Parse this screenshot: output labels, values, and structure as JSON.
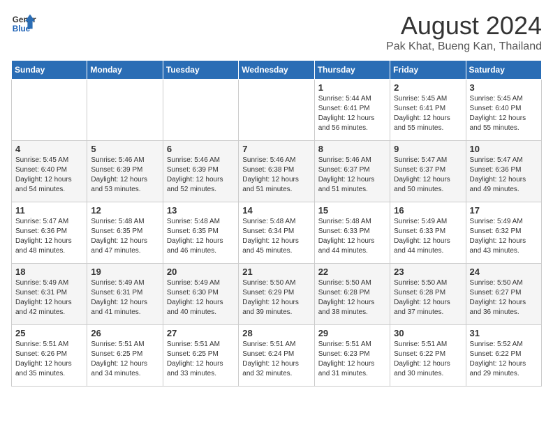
{
  "header": {
    "logo_line1": "General",
    "logo_line2": "Blue",
    "title": "August 2024",
    "subtitle": "Pak Khat, Bueng Kan, Thailand"
  },
  "weekdays": [
    "Sunday",
    "Monday",
    "Tuesday",
    "Wednesday",
    "Thursday",
    "Friday",
    "Saturday"
  ],
  "weeks": [
    [
      {
        "day": "",
        "content": ""
      },
      {
        "day": "",
        "content": ""
      },
      {
        "day": "",
        "content": ""
      },
      {
        "day": "",
        "content": ""
      },
      {
        "day": "1",
        "content": "Sunrise: 5:44 AM\nSunset: 6:41 PM\nDaylight: 12 hours\nand 56 minutes."
      },
      {
        "day": "2",
        "content": "Sunrise: 5:45 AM\nSunset: 6:41 PM\nDaylight: 12 hours\nand 55 minutes."
      },
      {
        "day": "3",
        "content": "Sunrise: 5:45 AM\nSunset: 6:40 PM\nDaylight: 12 hours\nand 55 minutes."
      }
    ],
    [
      {
        "day": "4",
        "content": "Sunrise: 5:45 AM\nSunset: 6:40 PM\nDaylight: 12 hours\nand 54 minutes."
      },
      {
        "day": "5",
        "content": "Sunrise: 5:46 AM\nSunset: 6:39 PM\nDaylight: 12 hours\nand 53 minutes."
      },
      {
        "day": "6",
        "content": "Sunrise: 5:46 AM\nSunset: 6:39 PM\nDaylight: 12 hours\nand 52 minutes."
      },
      {
        "day": "7",
        "content": "Sunrise: 5:46 AM\nSunset: 6:38 PM\nDaylight: 12 hours\nand 51 minutes."
      },
      {
        "day": "8",
        "content": "Sunrise: 5:46 AM\nSunset: 6:37 PM\nDaylight: 12 hours\nand 51 minutes."
      },
      {
        "day": "9",
        "content": "Sunrise: 5:47 AM\nSunset: 6:37 PM\nDaylight: 12 hours\nand 50 minutes."
      },
      {
        "day": "10",
        "content": "Sunrise: 5:47 AM\nSunset: 6:36 PM\nDaylight: 12 hours\nand 49 minutes."
      }
    ],
    [
      {
        "day": "11",
        "content": "Sunrise: 5:47 AM\nSunset: 6:36 PM\nDaylight: 12 hours\nand 48 minutes."
      },
      {
        "day": "12",
        "content": "Sunrise: 5:48 AM\nSunset: 6:35 PM\nDaylight: 12 hours\nand 47 minutes."
      },
      {
        "day": "13",
        "content": "Sunrise: 5:48 AM\nSunset: 6:35 PM\nDaylight: 12 hours\nand 46 minutes."
      },
      {
        "day": "14",
        "content": "Sunrise: 5:48 AM\nSunset: 6:34 PM\nDaylight: 12 hours\nand 45 minutes."
      },
      {
        "day": "15",
        "content": "Sunrise: 5:48 AM\nSunset: 6:33 PM\nDaylight: 12 hours\nand 44 minutes."
      },
      {
        "day": "16",
        "content": "Sunrise: 5:49 AM\nSunset: 6:33 PM\nDaylight: 12 hours\nand 44 minutes."
      },
      {
        "day": "17",
        "content": "Sunrise: 5:49 AM\nSunset: 6:32 PM\nDaylight: 12 hours\nand 43 minutes."
      }
    ],
    [
      {
        "day": "18",
        "content": "Sunrise: 5:49 AM\nSunset: 6:31 PM\nDaylight: 12 hours\nand 42 minutes."
      },
      {
        "day": "19",
        "content": "Sunrise: 5:49 AM\nSunset: 6:31 PM\nDaylight: 12 hours\nand 41 minutes."
      },
      {
        "day": "20",
        "content": "Sunrise: 5:49 AM\nSunset: 6:30 PM\nDaylight: 12 hours\nand 40 minutes."
      },
      {
        "day": "21",
        "content": "Sunrise: 5:50 AM\nSunset: 6:29 PM\nDaylight: 12 hours\nand 39 minutes."
      },
      {
        "day": "22",
        "content": "Sunrise: 5:50 AM\nSunset: 6:28 PM\nDaylight: 12 hours\nand 38 minutes."
      },
      {
        "day": "23",
        "content": "Sunrise: 5:50 AM\nSunset: 6:28 PM\nDaylight: 12 hours\nand 37 minutes."
      },
      {
        "day": "24",
        "content": "Sunrise: 5:50 AM\nSunset: 6:27 PM\nDaylight: 12 hours\nand 36 minutes."
      }
    ],
    [
      {
        "day": "25",
        "content": "Sunrise: 5:51 AM\nSunset: 6:26 PM\nDaylight: 12 hours\nand 35 minutes."
      },
      {
        "day": "26",
        "content": "Sunrise: 5:51 AM\nSunset: 6:25 PM\nDaylight: 12 hours\nand 34 minutes."
      },
      {
        "day": "27",
        "content": "Sunrise: 5:51 AM\nSunset: 6:25 PM\nDaylight: 12 hours\nand 33 minutes."
      },
      {
        "day": "28",
        "content": "Sunrise: 5:51 AM\nSunset: 6:24 PM\nDaylight: 12 hours\nand 32 minutes."
      },
      {
        "day": "29",
        "content": "Sunrise: 5:51 AM\nSunset: 6:23 PM\nDaylight: 12 hours\nand 31 minutes."
      },
      {
        "day": "30",
        "content": "Sunrise: 5:51 AM\nSunset: 6:22 PM\nDaylight: 12 hours\nand 30 minutes."
      },
      {
        "day": "31",
        "content": "Sunrise: 5:52 AM\nSunset: 6:22 PM\nDaylight: 12 hours\nand 29 minutes."
      }
    ]
  ]
}
